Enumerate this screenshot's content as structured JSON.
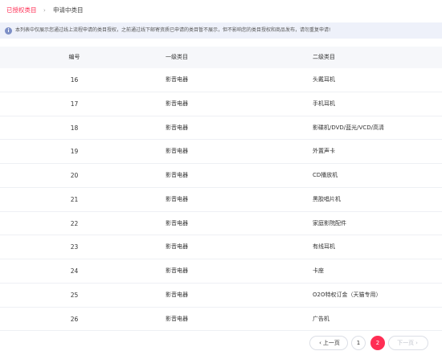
{
  "tabs": {
    "authorized": "已授权类目",
    "separator": "›",
    "applying": "申请中类目"
  },
  "notice": {
    "icon": "info-icon",
    "icon_glyph": "i",
    "text": "本列表中仅展示您通过线上流程申请的类目授权，之前通过线下邮寄资质已申请的类目暂不展示，但不影响您的类目授权和商品发布，请勿重复申请!"
  },
  "table": {
    "headers": [
      "编号",
      "一级类目",
      "二级类目"
    ],
    "rows": [
      [
        "16",
        "影音电器",
        "头戴耳机"
      ],
      [
        "17",
        "影音电器",
        "手机耳机"
      ],
      [
        "18",
        "影音电器",
        "影碟机/DVD/蓝光/VCD/高清"
      ],
      [
        "19",
        "影音电器",
        "外置声卡"
      ],
      [
        "20",
        "影音电器",
        "CD播放机"
      ],
      [
        "21",
        "影音电器",
        "黑胶唱片机"
      ],
      [
        "22",
        "影音电器",
        "家庭影院配件"
      ],
      [
        "23",
        "影音电器",
        "有线耳机"
      ],
      [
        "24",
        "影音电器",
        "卡座"
      ],
      [
        "25",
        "影音电器",
        "O2O特权订金（天猫专用）"
      ],
      [
        "26",
        "影音电器",
        "广告机"
      ]
    ]
  },
  "pagination": {
    "prev_label": "上一页",
    "prev_icon": "‹",
    "pages": [
      "1",
      "2"
    ],
    "current": "2",
    "next_label": "下一页",
    "next_icon": "›"
  },
  "colors": {
    "accent": "#ff2e54",
    "notice_bg": "#eef1fa",
    "header_bg": "#f6f7fa"
  }
}
